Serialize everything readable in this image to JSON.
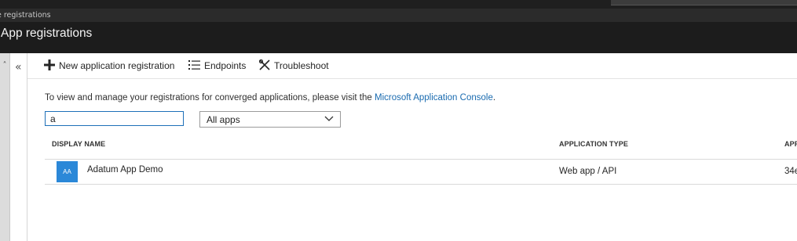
{
  "breadcrumb": "e registrations",
  "page_title": "App registrations",
  "rail": {
    "up_icon": "˄",
    "collapse_icon": "«"
  },
  "toolbar": {
    "new_label": "New application registration",
    "endpoints_label": "Endpoints",
    "troubleshoot_label": "Troubleshoot"
  },
  "info": {
    "text": "To view and manage your registrations for converged applications, please visit the ",
    "link": "Microsoft Application Console",
    "suffix": "."
  },
  "search": {
    "value": "a"
  },
  "filter": {
    "selected": "All apps"
  },
  "table": {
    "columns": [
      "DISPLAY NAME",
      "APPLICATION TYPE",
      "APF"
    ],
    "rows": [
      {
        "avatar": "AA",
        "name": "Adatum App Demo",
        "type": "Web app / API",
        "app_id": "34e"
      }
    ]
  },
  "colors": {
    "accent": "#1a6bb0",
    "avatar": "#2b88d8",
    "header_bg": "#1c1c1c"
  }
}
